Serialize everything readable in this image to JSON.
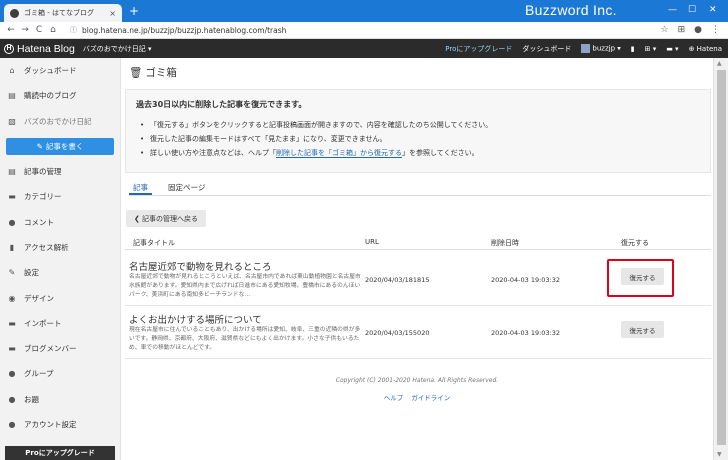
{
  "browser": {
    "tab_title": "ゴミ箱 - はてなブログ",
    "tab_close": "×",
    "new_tab": "+",
    "brand": "Buzzword Inc.",
    "url": "blog.hatena.ne.jp/buzzjp/buzzjp.hatenablog.com/trash",
    "win_min": "—",
    "win_max": "☐",
    "win_close": "✕",
    "back_glyph": "←",
    "fwd_glyph": "→",
    "reload_glyph": "C",
    "home_glyph": "⌂",
    "lock_glyph": "ⓘ",
    "star_glyph": "☆",
    "ext_glyph": "⊞",
    "account_glyph": "●",
    "menu_glyph": "⋮"
  },
  "header": {
    "logo_mark": "H",
    "logo": "Hatena Blog",
    "blog_name": "バズのおでかけ日記 ▾",
    "pro_link": "Proにアップグレード",
    "dashboard": "ダッシュボード",
    "user": "buzzjp ▾",
    "bookmark_glyph": "▮",
    "apps_glyph": "⊞ ▾",
    "msg_glyph": "▬ ▾",
    "hatena": "⊕ Hatena"
  },
  "sidebar": {
    "items": [
      {
        "label": "ダッシュボード",
        "icon": "⌂"
      },
      {
        "label": "購読中のブログ",
        "icon": "▤"
      },
      {
        "label": "バズのおでかけ日記",
        "icon": "▧"
      },
      {
        "label": "記事の管理",
        "icon": "▤"
      },
      {
        "label": "カテゴリー",
        "icon": "▬"
      },
      {
        "label": "コメント",
        "icon": "●"
      },
      {
        "label": "アクセス解析",
        "icon": "▮"
      },
      {
        "label": "設定",
        "icon": "✎"
      },
      {
        "label": "デザイン",
        "icon": "◉"
      },
      {
        "label": "インポート",
        "icon": "▬"
      },
      {
        "label": "ブログメンバー",
        "icon": "▬"
      },
      {
        "label": "グループ",
        "icon": "●"
      },
      {
        "label": "お題",
        "icon": "●"
      },
      {
        "label": "アカウント設定",
        "icon": "●"
      }
    ],
    "write_button": "記事を書く",
    "write_icon": "✎",
    "pro_upgrade": "Proにアップグレード"
  },
  "main": {
    "trash_icon": "🗑",
    "page_title": "ゴミ箱",
    "notice": {
      "heading": "過去30日以内に削除した記事を復元できます。",
      "line1": "「復元する」ボタンをクリックすると記事投稿画面が開きますので、内容を確認したのち公開してください。",
      "line2": "復元した記事の編集モードはすべて「見たまま」になり、変更できません。",
      "line3_pre": "詳しい使い方や注意点などは、ヘルプ「",
      "line3_link": "削除した記事を「ゴミ箱」から復元する",
      "line3_post": "」を参照してください。"
    },
    "tabs": [
      "記事",
      "固定ページ"
    ],
    "back_button": "❮ 記事の管理へ戻る",
    "columns": {
      "title": "記事タイトル",
      "url": "URL",
      "date": "削除日時",
      "restore": "復元する"
    },
    "rows": [
      {
        "title": "名古屋近郊で動物を見れるところ",
        "excerpt": "名古屋近郊で動物が見れるところといえば、名古屋市内であれば東山動植物園と名古屋市水族館があります。愛知県内まで広げれば日進市にある愛知牧場、豊橋市にあるのんほいパーク、美浜町にある南知多ビーチランドな…",
        "url": "2020/04/03/181815",
        "date": "2020-04-03 19:03:32",
        "button": "復元する"
      },
      {
        "title": "よくお出かけする場所について",
        "excerpt": "現在名古屋市に住んでいることもあり、出かける場所は愛知、岐阜、三重の近隣の県が多いです。静岡県、京都府、大阪府、滋賀県などにもよく出かけます。小さな子供もいるため、車での移動がほとんどです。",
        "url": "2020/04/03/155020",
        "date": "2020-04-03 19:03:32",
        "button": "復元する"
      }
    ],
    "footer": "Copyright (C) 2001-2020 Hatena. All Rights Reserved.",
    "footer_links": [
      "ヘルプ",
      "ガイドライン"
    ]
  }
}
